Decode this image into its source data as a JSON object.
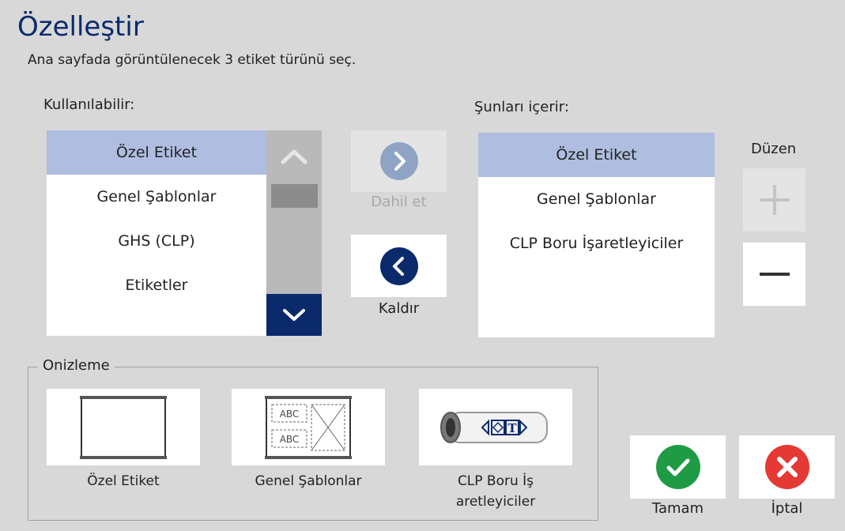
{
  "header": {
    "title": "Özelleştir",
    "subtitle": "Ana sayfada görüntülenecek 3 etiket türünü seç."
  },
  "available": {
    "label": "Kullanılabilir:",
    "items": [
      "Özel Etiket",
      "Genel Şablonlar",
      "GHS (CLP)",
      "Etiketler"
    ],
    "selected_index": 0
  },
  "actions": {
    "include_label": "Dahil et",
    "remove_label": "Kaldır"
  },
  "contains": {
    "label": "Şunları içerir:",
    "items": [
      "Özel Etiket",
      "Genel Şablonlar",
      "CLP Boru İşaretleyiciler"
    ],
    "selected_index": 0
  },
  "order": {
    "label": "Düzen"
  },
  "preview": {
    "legend": "Onizleme",
    "items": [
      {
        "caption": "Özel Etiket",
        "icon": "blank-label-icon"
      },
      {
        "caption": "Genel Şablonlar",
        "icon": "template-grid-icon",
        "icon_text": "ABC"
      },
      {
        "caption_line1": "CLP Boru İş",
        "caption_line2": "aretleyiciler",
        "icon": "pipe-marker-icon",
        "icon_text": "T"
      }
    ]
  },
  "buttons": {
    "ok_label": "Tamam",
    "cancel_label": "İptal"
  },
  "colors": {
    "brand_navy": "#0a2a6c",
    "selection": "#aebde0",
    "ok_green": "#1f9b45",
    "cancel_red": "#e53935",
    "disabled_gray": "#8fa4c4"
  }
}
